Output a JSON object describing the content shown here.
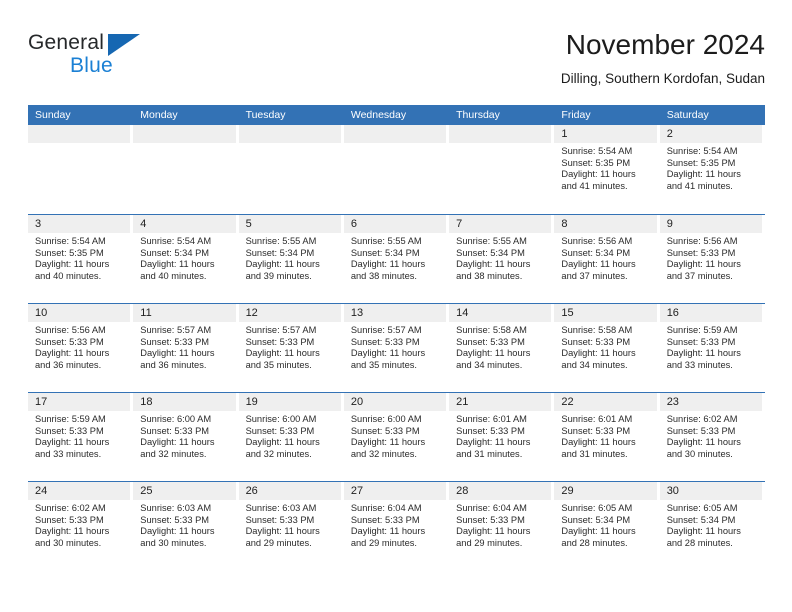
{
  "brand": {
    "line1": "General",
    "line2": "Blue",
    "triangle_color": "#1667b2",
    "blue_color": "#1b80d4"
  },
  "header": {
    "title": "November 2024",
    "location": "Dilling, Southern Kordofan, Sudan"
  },
  "calendar": {
    "accent_color": "#3372b5",
    "daynum_bg": "#efefef",
    "weekday_headers": [
      "Sunday",
      "Monday",
      "Tuesday",
      "Wednesday",
      "Thursday",
      "Friday",
      "Saturday"
    ],
    "weeks": [
      [
        {
          "day": "",
          "sunrise": "",
          "sunset": "",
          "daylight": "",
          "empty": true
        },
        {
          "day": "",
          "sunrise": "",
          "sunset": "",
          "daylight": "",
          "empty": true
        },
        {
          "day": "",
          "sunrise": "",
          "sunset": "",
          "daylight": "",
          "empty": true
        },
        {
          "day": "",
          "sunrise": "",
          "sunset": "",
          "daylight": "",
          "empty": true
        },
        {
          "day": "",
          "sunrise": "",
          "sunset": "",
          "daylight": "",
          "empty": true
        },
        {
          "day": "1",
          "sunrise": "Sunrise: 5:54 AM",
          "sunset": "Sunset: 5:35 PM",
          "daylight": "Daylight: 11 hours and 41 minutes."
        },
        {
          "day": "2",
          "sunrise": "Sunrise: 5:54 AM",
          "sunset": "Sunset: 5:35 PM",
          "daylight": "Daylight: 11 hours and 41 minutes."
        }
      ],
      [
        {
          "day": "3",
          "sunrise": "Sunrise: 5:54 AM",
          "sunset": "Sunset: 5:35 PM",
          "daylight": "Daylight: 11 hours and 40 minutes."
        },
        {
          "day": "4",
          "sunrise": "Sunrise: 5:54 AM",
          "sunset": "Sunset: 5:34 PM",
          "daylight": "Daylight: 11 hours and 40 minutes."
        },
        {
          "day": "5",
          "sunrise": "Sunrise: 5:55 AM",
          "sunset": "Sunset: 5:34 PM",
          "daylight": "Daylight: 11 hours and 39 minutes."
        },
        {
          "day": "6",
          "sunrise": "Sunrise: 5:55 AM",
          "sunset": "Sunset: 5:34 PM",
          "daylight": "Daylight: 11 hours and 38 minutes."
        },
        {
          "day": "7",
          "sunrise": "Sunrise: 5:55 AM",
          "sunset": "Sunset: 5:34 PM",
          "daylight": "Daylight: 11 hours and 38 minutes."
        },
        {
          "day": "8",
          "sunrise": "Sunrise: 5:56 AM",
          "sunset": "Sunset: 5:34 PM",
          "daylight": "Daylight: 11 hours and 37 minutes."
        },
        {
          "day": "9",
          "sunrise": "Sunrise: 5:56 AM",
          "sunset": "Sunset: 5:33 PM",
          "daylight": "Daylight: 11 hours and 37 minutes."
        }
      ],
      [
        {
          "day": "10",
          "sunrise": "Sunrise: 5:56 AM",
          "sunset": "Sunset: 5:33 PM",
          "daylight": "Daylight: 11 hours and 36 minutes."
        },
        {
          "day": "11",
          "sunrise": "Sunrise: 5:57 AM",
          "sunset": "Sunset: 5:33 PM",
          "daylight": "Daylight: 11 hours and 36 minutes."
        },
        {
          "day": "12",
          "sunrise": "Sunrise: 5:57 AM",
          "sunset": "Sunset: 5:33 PM",
          "daylight": "Daylight: 11 hours and 35 minutes."
        },
        {
          "day": "13",
          "sunrise": "Sunrise: 5:57 AM",
          "sunset": "Sunset: 5:33 PM",
          "daylight": "Daylight: 11 hours and 35 minutes."
        },
        {
          "day": "14",
          "sunrise": "Sunrise: 5:58 AM",
          "sunset": "Sunset: 5:33 PM",
          "daylight": "Daylight: 11 hours and 34 minutes."
        },
        {
          "day": "15",
          "sunrise": "Sunrise: 5:58 AM",
          "sunset": "Sunset: 5:33 PM",
          "daylight": "Daylight: 11 hours and 34 minutes."
        },
        {
          "day": "16",
          "sunrise": "Sunrise: 5:59 AM",
          "sunset": "Sunset: 5:33 PM",
          "daylight": "Daylight: 11 hours and 33 minutes."
        }
      ],
      [
        {
          "day": "17",
          "sunrise": "Sunrise: 5:59 AM",
          "sunset": "Sunset: 5:33 PM",
          "daylight": "Daylight: 11 hours and 33 minutes."
        },
        {
          "day": "18",
          "sunrise": "Sunrise: 6:00 AM",
          "sunset": "Sunset: 5:33 PM",
          "daylight": "Daylight: 11 hours and 32 minutes."
        },
        {
          "day": "19",
          "sunrise": "Sunrise: 6:00 AM",
          "sunset": "Sunset: 5:33 PM",
          "daylight": "Daylight: 11 hours and 32 minutes."
        },
        {
          "day": "20",
          "sunrise": "Sunrise: 6:00 AM",
          "sunset": "Sunset: 5:33 PM",
          "daylight": "Daylight: 11 hours and 32 minutes."
        },
        {
          "day": "21",
          "sunrise": "Sunrise: 6:01 AM",
          "sunset": "Sunset: 5:33 PM",
          "daylight": "Daylight: 11 hours and 31 minutes."
        },
        {
          "day": "22",
          "sunrise": "Sunrise: 6:01 AM",
          "sunset": "Sunset: 5:33 PM",
          "daylight": "Daylight: 11 hours and 31 minutes."
        },
        {
          "day": "23",
          "sunrise": "Sunrise: 6:02 AM",
          "sunset": "Sunset: 5:33 PM",
          "daylight": "Daylight: 11 hours and 30 minutes."
        }
      ],
      [
        {
          "day": "24",
          "sunrise": "Sunrise: 6:02 AM",
          "sunset": "Sunset: 5:33 PM",
          "daylight": "Daylight: 11 hours and 30 minutes."
        },
        {
          "day": "25",
          "sunrise": "Sunrise: 6:03 AM",
          "sunset": "Sunset: 5:33 PM",
          "daylight": "Daylight: 11 hours and 30 minutes."
        },
        {
          "day": "26",
          "sunrise": "Sunrise: 6:03 AM",
          "sunset": "Sunset: 5:33 PM",
          "daylight": "Daylight: 11 hours and 29 minutes."
        },
        {
          "day": "27",
          "sunrise": "Sunrise: 6:04 AM",
          "sunset": "Sunset: 5:33 PM",
          "daylight": "Daylight: 11 hours and 29 minutes."
        },
        {
          "day": "28",
          "sunrise": "Sunrise: 6:04 AM",
          "sunset": "Sunset: 5:33 PM",
          "daylight": "Daylight: 11 hours and 29 minutes."
        },
        {
          "day": "29",
          "sunrise": "Sunrise: 6:05 AM",
          "sunset": "Sunset: 5:34 PM",
          "daylight": "Daylight: 11 hours and 28 minutes."
        },
        {
          "day": "30",
          "sunrise": "Sunrise: 6:05 AM",
          "sunset": "Sunset: 5:34 PM",
          "daylight": "Daylight: 11 hours and 28 minutes."
        }
      ]
    ]
  }
}
